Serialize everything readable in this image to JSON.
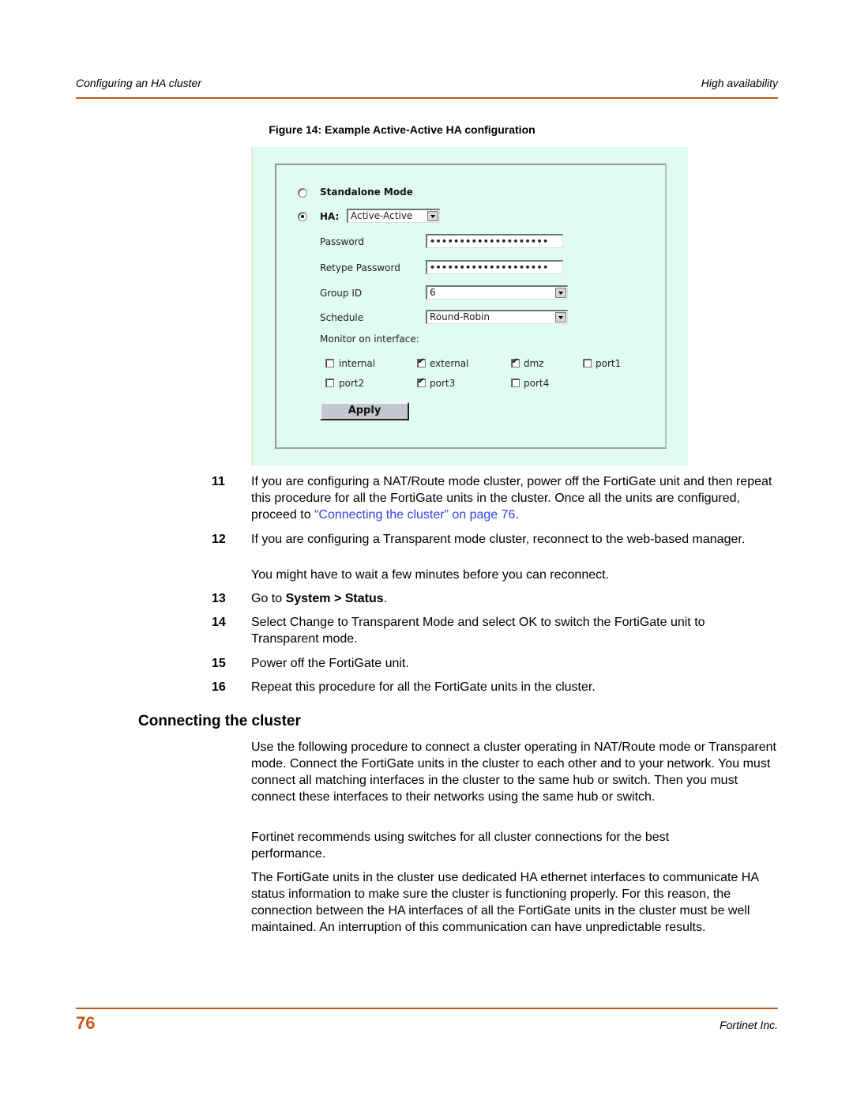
{
  "header": {
    "left": "Configuring an HA cluster",
    "right": "High availability"
  },
  "figure": {
    "caption": "Figure 14: Example Active-Active HA configuration",
    "form": {
      "standalone_label": "Standalone Mode",
      "standalone_selected": false,
      "ha_label": "HA:",
      "ha_selected": true,
      "ha_mode": "Active-Active",
      "password_label": "Password",
      "password_value": "••••••••••••••••••••",
      "retype_label": "Retype Password",
      "retype_value": "••••••••••••••••••••",
      "group_id_label": "Group ID",
      "group_id_value": "6",
      "schedule_label": "Schedule",
      "schedule_value": "Round-Robin",
      "monitor_label": "Monitor on interface:",
      "interfaces": [
        {
          "name": "internal",
          "checked": false
        },
        {
          "name": "external",
          "checked": true
        },
        {
          "name": "dmz",
          "checked": true
        },
        {
          "name": "port1",
          "checked": false
        },
        {
          "name": "port2",
          "checked": false
        },
        {
          "name": "port3",
          "checked": true
        },
        {
          "name": "port4",
          "checked": false
        }
      ],
      "apply_label": "Apply"
    }
  },
  "steps": [
    {
      "num": "11",
      "text_before": "If you are configuring a NAT/Route mode cluster, power off the FortiGate unit and then repeat this procedure for all the FortiGate units in the cluster. Once all the units are configured, proceed to ",
      "link": "“Connecting the cluster” on page 76",
      "text_after": "."
    },
    {
      "num": "12",
      "text": "If you are configuring a Transparent mode cluster, reconnect to the web-based manager.",
      "note": "You might have to wait a few minutes before you can reconnect."
    },
    {
      "num": "13",
      "text_before": "Go to ",
      "bold": "System > Status",
      "text_after": "."
    },
    {
      "num": "14",
      "text": "Select Change to Transparent Mode and select OK to switch the FortiGate unit to Transparent mode."
    },
    {
      "num": "15",
      "text": "Power off the FortiGate unit."
    },
    {
      "num": "16",
      "text": "Repeat this procedure for all the FortiGate units in the cluster."
    }
  ],
  "section": {
    "heading": "Connecting the cluster",
    "paragraphs": [
      "Use the following procedure to connect a cluster operating in NAT/Route mode or Transparent mode. Connect the FortiGate units in the cluster to each other and to your network. You must connect all matching interfaces in the cluster to the same hub or switch. Then you must connect these interfaces to their networks using the same hub or switch.",
      "Fortinet recommends using switches for all cluster connections for the best performance.",
      "The FortiGate units in the cluster use dedicated HA ethernet interfaces to communicate HA status information to make sure the cluster is functioning properly. For this reason, the connection between the HA interfaces of all the FortiGate units in the cluster must be well maintained. An interruption of this communication can have unpredictable results."
    ]
  },
  "footer": {
    "page_number": "76",
    "company": "Fortinet Inc."
  },
  "colors": {
    "accent": "#c8581a",
    "link": "#3344dd",
    "figure_bg": "#e0fbef"
  }
}
